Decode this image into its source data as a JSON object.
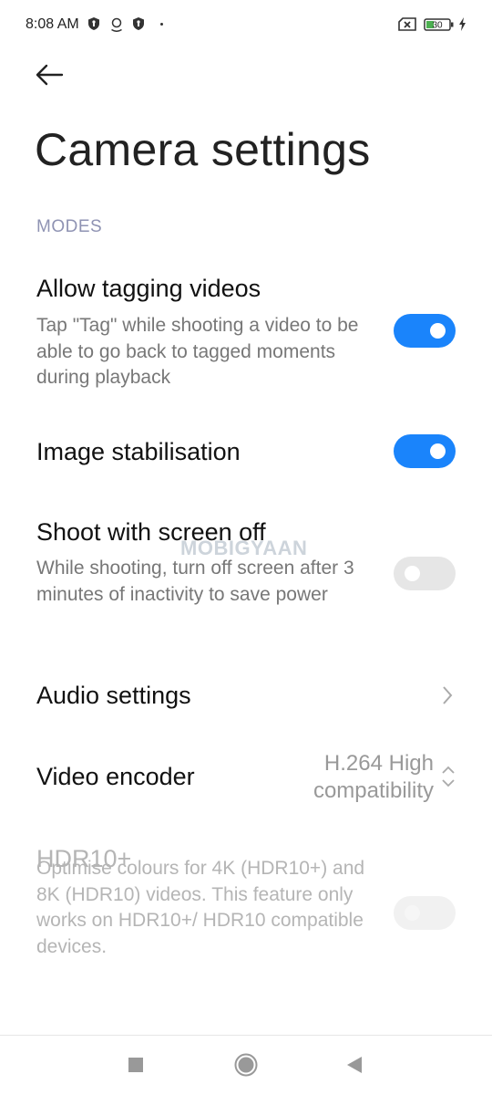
{
  "status_bar": {
    "time": "8:08 AM",
    "icons": [
      "shield-icon",
      "location-icon",
      "shield-icon",
      "notification-dot",
      "sim-missing-icon",
      "battery-icon",
      "charging-icon"
    ],
    "battery_level": "30",
    "battery_color": "#4caf50"
  },
  "header": {
    "back_icon": "arrow-left-icon",
    "title": "Camera settings"
  },
  "section": {
    "label": "MODES"
  },
  "settings": [
    {
      "title": "Allow tagging videos",
      "description": "Tap \"Tag\" while shooting a video to be able to go back to tagged moments during playback",
      "control": "toggle",
      "state": "on",
      "enabled": true
    },
    {
      "title": "Image stabilisation",
      "description": "",
      "control": "toggle",
      "state": "on",
      "enabled": true
    },
    {
      "title": "Shoot with screen off",
      "description": "While shooting, turn off screen after 3 minutes of inactivity to save power",
      "control": "toggle",
      "state": "off",
      "enabled": true
    },
    {
      "title": "Audio settings",
      "control": "chevron-right-icon"
    },
    {
      "title": "Video encoder",
      "value_line1": "H.264 High",
      "value_line2": "compatibility",
      "control": "chevron-up-down-icon"
    },
    {
      "title": "HDR10+",
      "description": "Optimise colours for 4K (HDR10+) and 8K (HDR10) videos. This feature only works on HDR10+/ HDR10 compatible devices.",
      "control": "toggle",
      "state": "off",
      "enabled": false
    }
  ],
  "watermark": "MOBIGYAAN",
  "colors": {
    "accent": "#1a84fb",
    "section_label": "#8f93b3",
    "toggle_off": "#e6e6e6"
  },
  "nav_bar": {
    "buttons": [
      "recents-square-icon",
      "home-circle-icon",
      "back-triangle-icon"
    ]
  }
}
